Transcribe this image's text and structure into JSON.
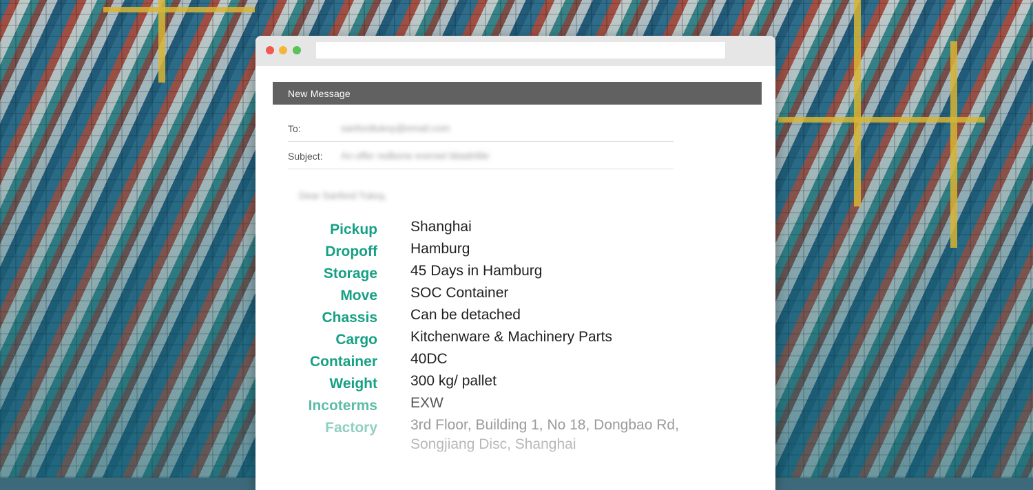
{
  "compose": {
    "title": "New Message",
    "to_label": "To:",
    "to_value": "sanfordtukoy@email.com",
    "subject_label": "Subject:",
    "subject_value": "An offer redbone everset bbadrittle"
  },
  "greeting": "Dear Sanford Tukoy,",
  "details": [
    {
      "label": "Pickup",
      "value": "Shanghai"
    },
    {
      "label": "Dropoff",
      "value": "Hamburg"
    },
    {
      "label": "Storage",
      "value": "45 Days in Hamburg"
    },
    {
      "label": "Move",
      "value": "SOC Container"
    },
    {
      "label": "Chassis",
      "value": "Can be detached"
    },
    {
      "label": "Cargo",
      "value": "Kitchenware & Machinery Parts"
    },
    {
      "label": "Container",
      "value": "40DC"
    },
    {
      "label": "Weight",
      "value": "300 kg/ pallet"
    },
    {
      "label": "Incoterms",
      "value": "EXW"
    },
    {
      "label": "Factory",
      "value": "3rd Floor, Building 1, No 18, Dongbao Rd,",
      "value_line2": "Songjiang Disc, Shanghai"
    }
  ],
  "colors": {
    "accent": "#16a085",
    "header_bar": "#616161"
  }
}
